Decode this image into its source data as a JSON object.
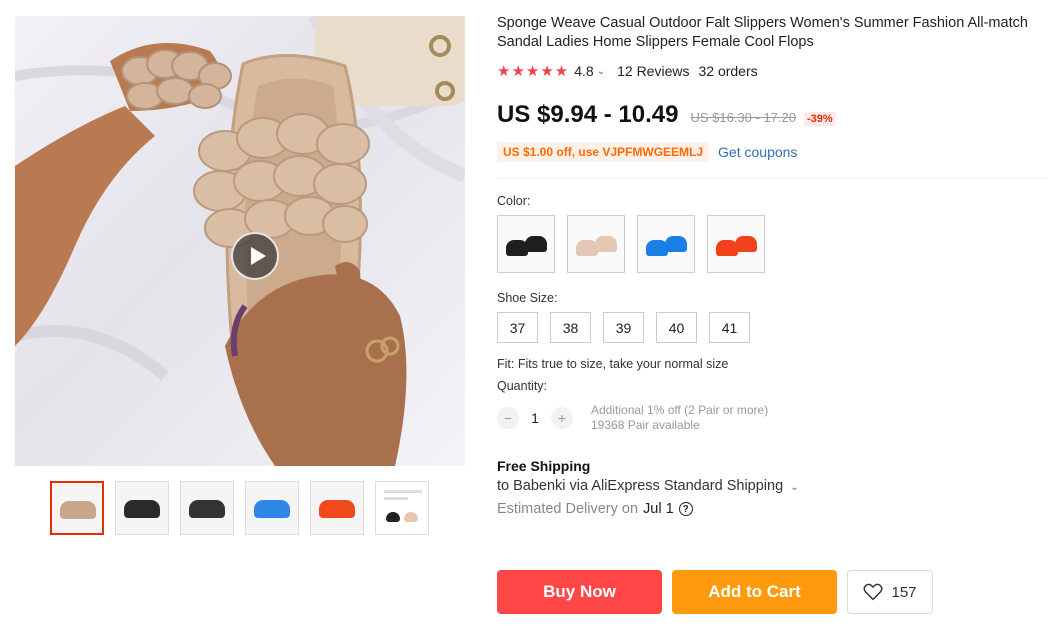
{
  "product": {
    "title": "Sponge Weave Casual Outdoor Falt Slippers Women's Summer Fashion All-match Sandal Ladies Home Slippers Female Cool Flops",
    "stars": "★★★★★",
    "rating": "4.8",
    "reviews": "12 Reviews",
    "orders": "32 orders"
  },
  "pricing": {
    "price": "US $9.94 - 10.49",
    "old_price": "US $16.30 - 17.20",
    "discount": "-39%",
    "coupon": "US $1.00 off, use VJPFMWGEEMLJ",
    "get_coupons": "Get coupons"
  },
  "options": {
    "color_label": "Color:",
    "colors": [
      "#1e1e1e",
      "#e3c9b5",
      "#1a7fe6",
      "#f2421b"
    ],
    "size_label": "Shoe Size:",
    "sizes": [
      "37",
      "38",
      "39",
      "40",
      "41"
    ],
    "fit": "Fit: Fits true to size, take your normal size"
  },
  "quantity": {
    "label": "Quantity:",
    "minus": "−",
    "value": "1",
    "plus": "+",
    "info1": "Additional 1% off (2 Pair or more)",
    "info2": "19368 Pair available"
  },
  "shipping": {
    "title": "Free Shipping",
    "to": "to Babenki via AliExpress Standard Shipping",
    "est_label": "Estimated Delivery on",
    "est_date": "Jul 1"
  },
  "actions": {
    "buy": "Buy Now",
    "cart": "Add to Cart",
    "wish_count": "157"
  },
  "gallery": {
    "thumb_colors": [
      "#c9a58a",
      "#2a2a2a",
      "#333333",
      "#2f86e8",
      "#f04a1c",
      "#ffffff"
    ]
  }
}
